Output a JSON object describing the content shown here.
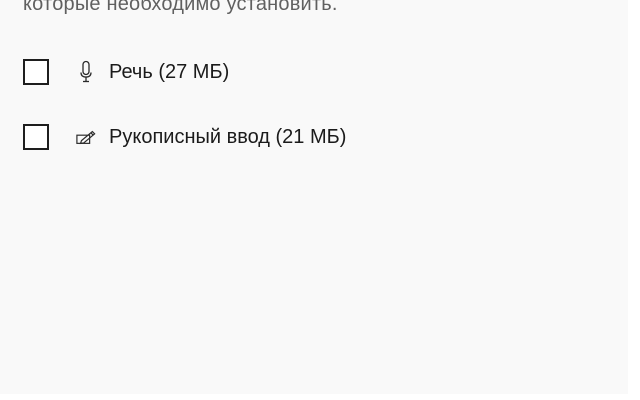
{
  "intro": {
    "text": "которые необходимо установить."
  },
  "features": [
    {
      "label": "Речь (27 МБ)",
      "icon": "microphone-icon",
      "checked": false
    },
    {
      "label": "Рукописный ввод (21 МБ)",
      "icon": "handwriting-pen-icon",
      "checked": false
    }
  ],
  "colors": {
    "panel_background": "#f9f9f9",
    "checkbox_border": "#1e1e1e",
    "text": "#1b1b1b",
    "secondary_text": "#606060"
  }
}
